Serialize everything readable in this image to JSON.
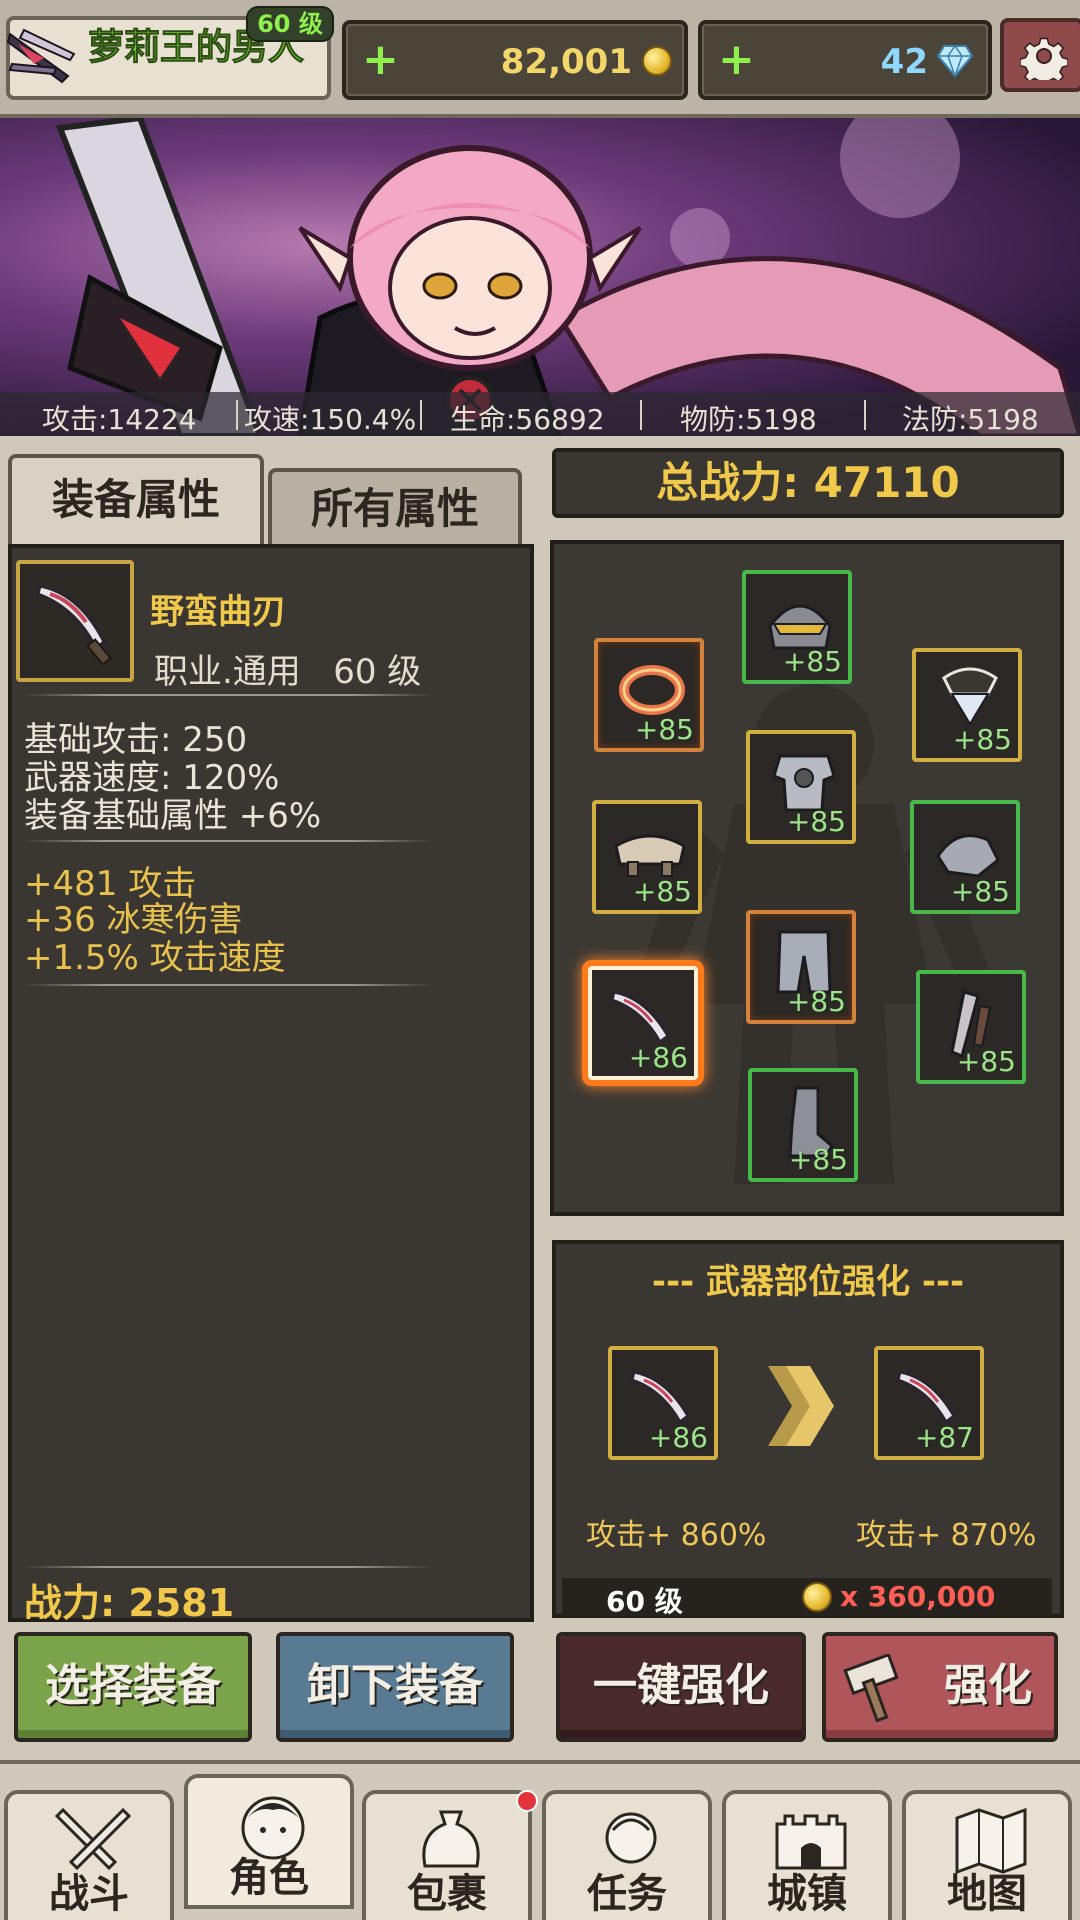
{
  "player": {
    "name": "萝莉王的男人",
    "level": "60 级"
  },
  "resources": {
    "gold": "82,001",
    "gems": "42"
  },
  "stats": [
    {
      "text": "攻击:14224"
    },
    {
      "text": "攻速:150.4%"
    },
    {
      "text": "生命:56892"
    },
    {
      "text": "物防:5198"
    },
    {
      "text": "法防:5198"
    }
  ],
  "tabs": {
    "equip_attr": "装备属性",
    "all_attr": "所有属性"
  },
  "item": {
    "name": "野蛮曲刃",
    "job_level": "职业.通用   60 级",
    "base": [
      "基础攻击:  250",
      "武器速度:  120%",
      "装备基础属性 +6%"
    ],
    "bonus": [
      "+481 攻击",
      "+36 冰寒伤害",
      "+1.5% 攻击速度"
    ],
    "power": "战力: 2581"
  },
  "total_power": "总战力: 47110",
  "equipment": {
    "helmet": "+85",
    "ring": "+85",
    "necklace": "+85",
    "chest": "+85",
    "shoulder": "+85",
    "gloves": "+85",
    "weapon": "+86",
    "pants": "+85",
    "offhand": "+85",
    "boots": "+85"
  },
  "enhance": {
    "title": "--- 武器部位强化 ---",
    "from_level": "+86",
    "to_level": "+87",
    "from_value": "攻击+ 860%",
    "to_value": "攻击+ 870%",
    "req_level": "60 级",
    "cost": "x 360,000"
  },
  "buttons": {
    "select": "选择装备",
    "unequip": "卸下装备",
    "auto_enhance": "一键强化",
    "enhance": "强化"
  },
  "nav": [
    {
      "label": "战斗",
      "icon": "swords-icon"
    },
    {
      "label": "角色",
      "icon": "character-icon"
    },
    {
      "label": "包裹",
      "icon": "bag-icon"
    },
    {
      "label": "任务",
      "icon": "quest-icon"
    },
    {
      "label": "城镇",
      "icon": "castle-icon"
    },
    {
      "label": "地图",
      "icon": "map-icon"
    }
  ],
  "colors": {
    "gold_text": "#f1c94a",
    "green_text": "#8ef04d",
    "panel": "#3a3631"
  }
}
